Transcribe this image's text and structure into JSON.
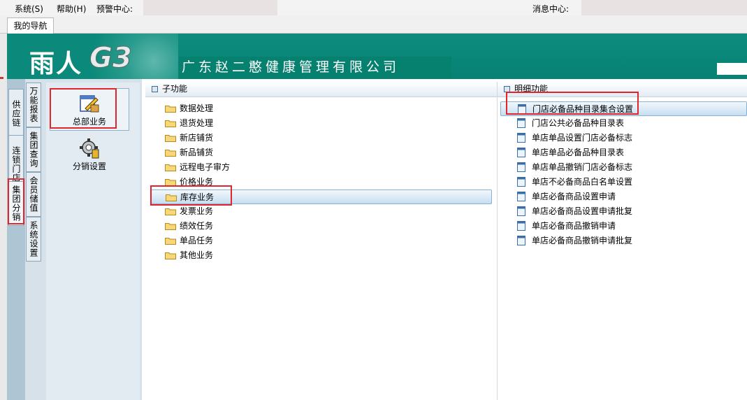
{
  "menubar": {
    "system": "系统(S)",
    "help": "帮助(H)",
    "alert_center": "预警中心:",
    "message_center": "消息中心:"
  },
  "tabs": [
    {
      "label": "我的导航"
    }
  ],
  "banner": {
    "brand": "雨人",
    "logo": "G3",
    "company": "广东赵二憨健康管理有限公司"
  },
  "side_tabs_outer": [
    {
      "label": "供应链"
    },
    {
      "label": "连锁门店"
    },
    {
      "label": "集团分销"
    }
  ],
  "side_tabs_inner": [
    {
      "label": "万能报表"
    },
    {
      "label": "集团查询"
    },
    {
      "label": "会员储值"
    },
    {
      "label": "系统设置"
    }
  ],
  "icon_panel": [
    {
      "label": "总部业务",
      "icon": "edit-document-icon",
      "selected": true
    },
    {
      "label": "分销设置",
      "icon": "gear-settings-icon",
      "selected": false
    }
  ],
  "sub_functions": {
    "header": "子功能",
    "items": [
      "数据处理",
      "退货处理",
      "新店铺货",
      "新品铺货",
      "远程电子审方",
      "价格业务",
      "库存业务",
      "发票业务",
      "绩效任务",
      "单品任务",
      "其他业务"
    ],
    "selected": "库存业务"
  },
  "detail_functions": {
    "header": "明细功能",
    "items": [
      "门店必备品种目录集合设置",
      "门店公共必备品种目录表",
      "单店单品设置门店必备标志",
      "单店单品必备品种目录表",
      "单店单品撤销门店必备标志",
      "单店不必备商品白名单设置",
      "单店必备商品设置申请",
      "单店必备商品设置申请批复",
      "单店必备商品撤销申请",
      "单店必备商品撤销申请批复"
    ],
    "selected": "门店必备品种目录集合设置"
  },
  "colors": {
    "banner": "#0b897a",
    "highlight_border": "#e0262c",
    "side_panel": "#d6e1ea"
  }
}
